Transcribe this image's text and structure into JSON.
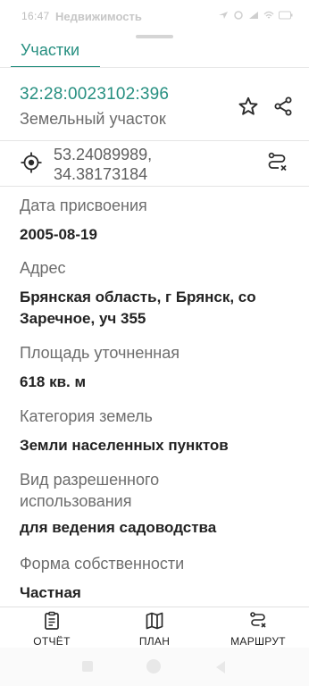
{
  "status_bar": {
    "time": "16:47",
    "app_title": "Недвижимость"
  },
  "tabs": [
    {
      "label": "Участки",
      "active": true
    }
  ],
  "parcel": {
    "cadastral_number": "32:28:0023102:396",
    "type": "Земельный участок",
    "coordinates_line1": "53.24089989,",
    "coordinates_line2": "34.38173184"
  },
  "fields": [
    {
      "label": "Дата присвоения",
      "value": "2005-08-19"
    },
    {
      "label": "Адрес",
      "value": "Брянская область, г Брянск, со Заречное, уч 355"
    },
    {
      "label": "Площадь уточненная",
      "value": "618 кв. м"
    },
    {
      "label": "Категория земель",
      "value": "Земли населенных пунктов"
    },
    {
      "label": "Вид разрешенного использования",
      "value": "для ведения садоводства"
    },
    {
      "label": "Форма собственности",
      "value": "Частная"
    }
  ],
  "bottom_nav": {
    "report": "ОТЧЁТ",
    "plan": "ПЛАН",
    "route": "МАРШРУТ"
  },
  "colors": {
    "accent": "#268f80",
    "text_primary": "#222222",
    "text_secondary": "#6d6d6d",
    "divider": "#e4e4e4"
  },
  "icons": {
    "favorite": "star-outline-icon",
    "share": "share-icon",
    "location": "crosshair-target-icon",
    "route": "route-icon",
    "report": "document-report-icon",
    "plan": "map-icon",
    "route_nav": "route-icon"
  }
}
